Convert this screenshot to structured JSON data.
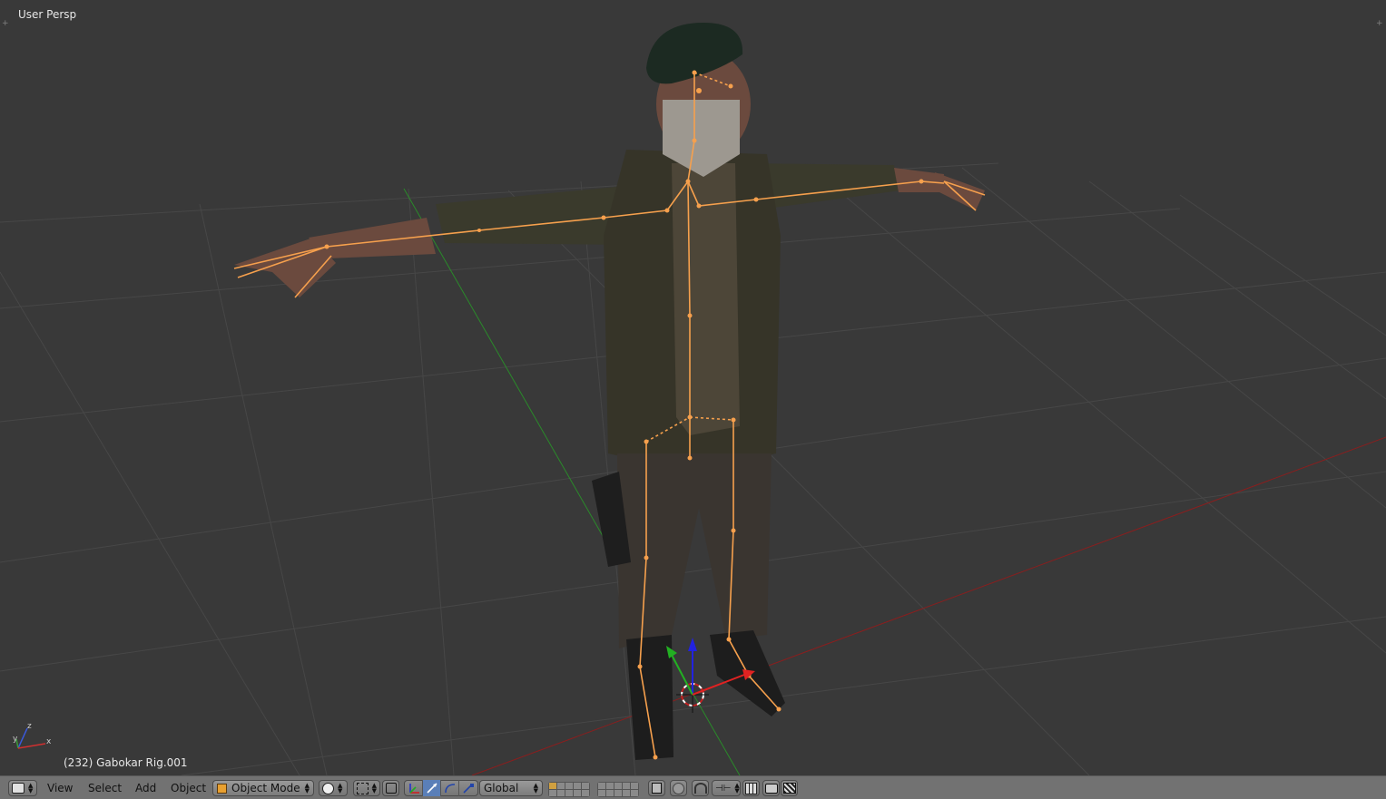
{
  "viewport": {
    "view_name": "User Persp",
    "object_info": "(232) Gabokar Rig.001",
    "corner_left": "+",
    "corner_right": "+",
    "grid_color": "#474747",
    "background": "#393939",
    "x_axis_color": "#8a1e1e",
    "y_axis_color": "#2a8a2a",
    "armature_color": "#f6a04d",
    "axis_gizmo": {
      "x": "x",
      "y": "y",
      "z": "z"
    }
  },
  "header": {
    "editor_type_icon": "3d-view-icon",
    "menus": [
      "View",
      "Select",
      "Add",
      "Object"
    ],
    "mode": {
      "label": "Object Mode",
      "icon": "cube-icon"
    },
    "shading_icon": "solid-sphere-icon",
    "pivot_icon": "pivot-bounding-box-icon",
    "manipulator_icons": [
      "translate-icon",
      "rotate-icon",
      "scale-icon"
    ],
    "orientation": "Global",
    "snap_icons": [
      "layers-icon",
      "proportional-edit-icon",
      "snap-icon",
      "render-icon",
      "camera-icon"
    ]
  }
}
